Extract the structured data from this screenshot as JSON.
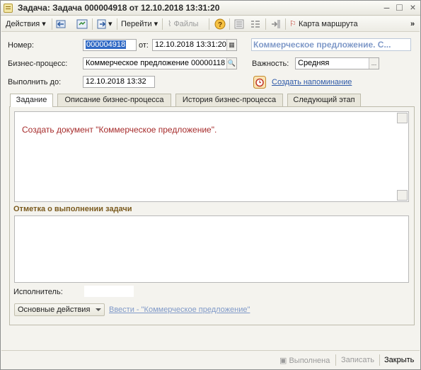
{
  "window": {
    "title": "Задача: Задача 000004918 от 12.10.2018 13:31:20",
    "minimize": "–",
    "maximize": "□",
    "close": "×"
  },
  "toolbar": {
    "actions": "Действия",
    "goto": "Перейти",
    "files": "Файлы",
    "route_map": "Карта маршрута",
    "overflow": "»"
  },
  "form": {
    "number_label": "Номер:",
    "number_value": "000004918",
    "from_label": "от:",
    "date_value": "12.10.2018 13:31:20",
    "bp_title": "Коммерческое предложение. С...",
    "business_process_label": "Бизнес-процесс:",
    "business_process_value": "Коммерческое предложение 00000118",
    "importance_label": "Важность:",
    "importance_value": "Средняя",
    "due_label": "Выполнить до:",
    "due_value": "12.10.2018  13:32",
    "reminder_link": "Создать напоминание"
  },
  "tabs": [
    {
      "label": "Задание"
    },
    {
      "label": "Описание бизнес-процесса"
    },
    {
      "label": "История бизнес-процесса"
    },
    {
      "label": "Следующий этап"
    }
  ],
  "task": {
    "text": "Создать документ \"Коммерческое предложение\"."
  },
  "completion": {
    "title": "Отметка о выполнении задачи",
    "note": ""
  },
  "executor": {
    "label": "Исполнитель:",
    "value": ""
  },
  "actions": {
    "main_actions": "Основные действия",
    "input_link": "Ввести - \"Коммерческое предложение\""
  },
  "bottom": {
    "done": "Выполнена",
    "save": "Записать",
    "close": "Закрыть"
  }
}
